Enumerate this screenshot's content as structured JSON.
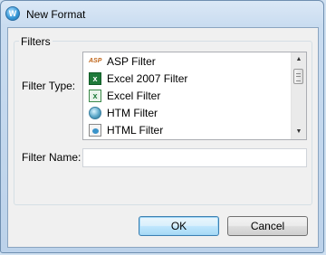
{
  "window": {
    "title": "New Format",
    "app_icon": "app-logo-icon"
  },
  "filters_group": {
    "label": "Filters",
    "filter_type_label": "Filter Type:",
    "filter_name_label": "Filter Name:",
    "filter_name_value": "",
    "items": [
      {
        "label": "ASP Filter",
        "icon": "asp-file-icon"
      },
      {
        "label": "Excel 2007 Filter",
        "icon": "excel-2007-icon"
      },
      {
        "label": "Excel Filter",
        "icon": "excel-icon"
      },
      {
        "label": "HTM Filter",
        "icon": "htm-globe-icon"
      },
      {
        "label": "HTML Filter",
        "icon": "html-page-icon"
      }
    ]
  },
  "buttons": {
    "ok": "OK",
    "cancel": "Cancel"
  },
  "colors": {
    "frame": "#bcd2ea",
    "client_bg": "#f0f0f0",
    "ok_button_border": "#3c7fb1"
  }
}
